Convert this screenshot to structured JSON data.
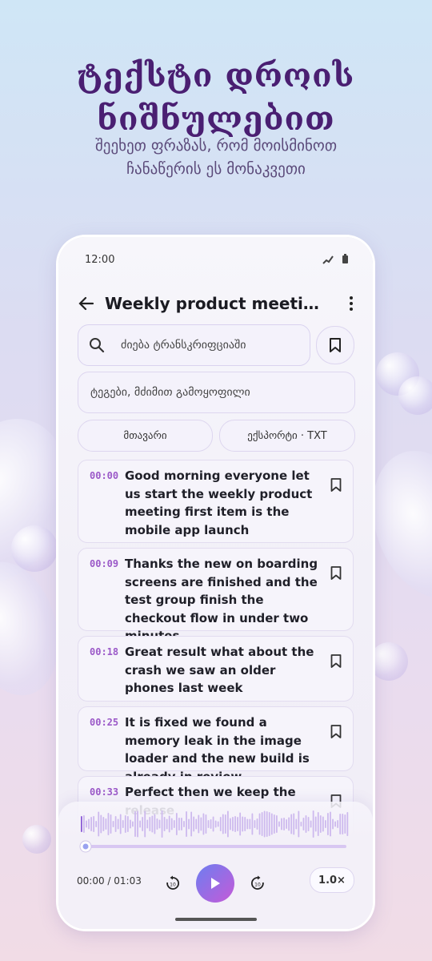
{
  "hero": {
    "title_line1": "ტექსტი დროის",
    "title_line2": "ნიშნულებით",
    "subtitle_line1": "შეეხეთ ფრაზას, რომ მოისმინოთ",
    "subtitle_line2": "ჩანაწერის ეს მონაკვეთი"
  },
  "status_bar": {
    "time": "12:00"
  },
  "app_bar": {
    "title": "Weekly product meeting.m..."
  },
  "search": {
    "placeholder": "ძიება ტრანსკრიფციაში"
  },
  "tags_field": {
    "placeholder": "ტეგები, მძიმით გამოყოფილი"
  },
  "buttons": {
    "main": "მთავარი",
    "export": "ექსპორტი · TXT"
  },
  "segments": [
    {
      "time": "00:00",
      "text": "Good morning everyone let us start the weekly product meeting first item is the mobile app launch"
    },
    {
      "time": "00:09",
      "text": "Thanks the new on boarding screens are finished and the test group finish the checkout flow in under two minutes"
    },
    {
      "time": "00:18",
      "text": "Great result what about the crash we saw an older phones last week"
    },
    {
      "time": "00:25",
      "text": "It is fixed we found a memory leak in the image loader and the new build is already in review"
    },
    {
      "time": "00:33",
      "text": "Perfect then we keep the release"
    }
  ],
  "player": {
    "time_display": "00:00 / 01:03",
    "speed": "1.0×",
    "progress": 0.0,
    "rewind_seconds": "10",
    "forward_seconds": "10"
  },
  "colors": {
    "accent": "#9b59c8",
    "title": "#4a1f72"
  }
}
